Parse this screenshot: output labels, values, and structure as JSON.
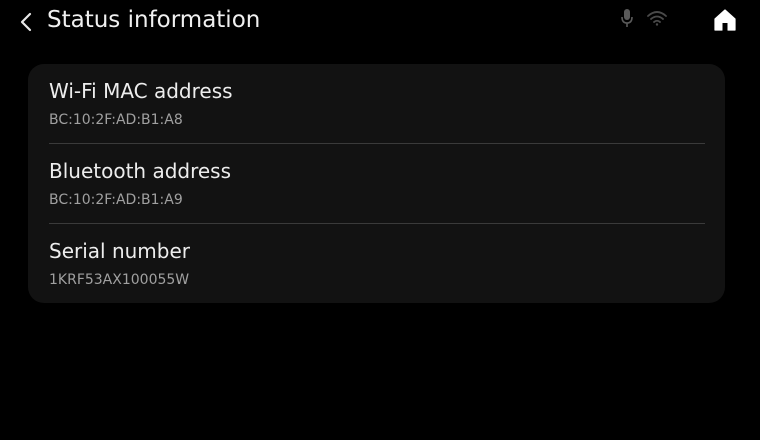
{
  "header": {
    "title": "Status information",
    "back_icon": "chevron-left-icon",
    "home_icon": "home-icon"
  },
  "status_bar": {
    "icons": [
      "microphone-icon",
      "wifi-icon"
    ]
  },
  "colors": {
    "background": "#000000",
    "card": "#121212",
    "divider": "#3a3a3a",
    "label": "#ededed",
    "value": "#a0a0a0"
  },
  "info_list": [
    {
      "label": "Wi-Fi MAC address",
      "value": "BC:10:2F:AD:B1:A8"
    },
    {
      "label": "Bluetooth address",
      "value": "BC:10:2F:AD:B1:A9"
    },
    {
      "label": "Serial number",
      "value": "1KRF53AX100055W"
    }
  ]
}
